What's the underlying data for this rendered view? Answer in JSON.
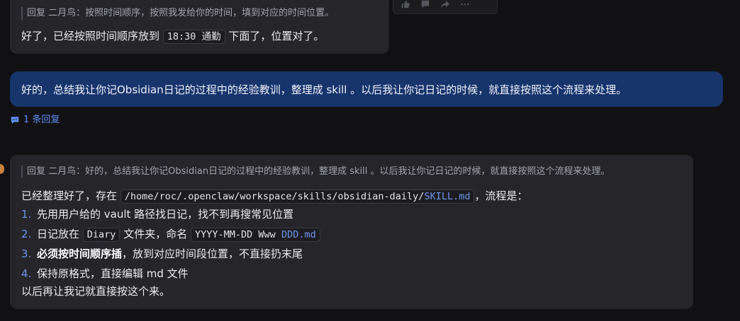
{
  "message1": {
    "quote": "回复 二月鸟：按照时间顺序，按照我发给你的时间，填到对应的时间位置。",
    "text_before": "好了，已经按照时间顺序放到",
    "code": "18:30 通勤",
    "text_after": "下面了，位置对了。"
  },
  "toolbar": {
    "icons": [
      "thumbs-up-icon",
      "comment-icon",
      "share-icon",
      "more-icon"
    ]
  },
  "message2": {
    "text": "好的，总结我让你记Obsidian日记的过程中的经验教训，整理成 skill 。以后我让你记日记的时候，就直接按照这个流程来处理。"
  },
  "thread": {
    "label": "1 条回复"
  },
  "message3": {
    "quote": "回复 二月鸟：好的，总结我让你记Obsidian日记的过程中的经验教训，整理成 skill 。以后我让你记日记的时候，就直接按照这个流程来处理。",
    "intro_before": "已经整理好了，存在",
    "path_plain": "/home/roc/.openclaw/workspace/skills/obsidian-daily/",
    "path_link": "SKILL.md",
    "intro_after": "，流程是：",
    "steps": [
      {
        "num": "1.",
        "text": "先用用户给的 vault 路径找日记，找不到再搜常见位置"
      },
      {
        "num": "2.",
        "text_before": "日记放在",
        "code1": "Diary",
        "text_mid": "文件夹，命名",
        "code2_plain": "YYYY-MM-DD Www ",
        "code2_link": "DDD.md"
      },
      {
        "num": "3.",
        "bold": "必须按时间顺序插",
        "text": "，放到对应时间段位置，不直接扔末尾"
      },
      {
        "num": "4.",
        "text": "保持原格式，直接编辑 md 文件"
      }
    ],
    "closing": "以后再让我记就直接按这个来。"
  },
  "colors": {
    "background": "#111113",
    "bot_bubble": "#25252a",
    "user_bubble": "#17346b",
    "link": "#6f95e8",
    "thread_link": "#5d8ef0"
  }
}
